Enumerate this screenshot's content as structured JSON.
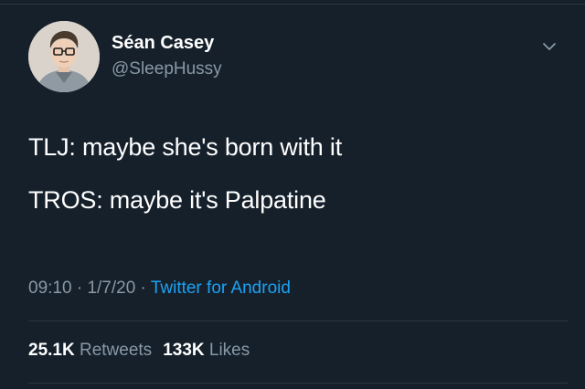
{
  "author": {
    "display_name": "Séan Casey",
    "handle": "@SleepHussy"
  },
  "tweet": {
    "lines": [
      "TLJ: maybe she's born with it",
      "TROS: maybe it's Palpatine"
    ]
  },
  "meta": {
    "time": "09:10",
    "separator": "·",
    "date": "1/7/20",
    "source": "Twitter for Android"
  },
  "stats": {
    "retweets_count": "25.1K",
    "retweets_label": "Retweets",
    "likes_count": "133K",
    "likes_label": "Likes"
  },
  "icons": {
    "more": "chevron-down-icon"
  },
  "colors": {
    "background": "#15202b",
    "text": "#ffffff",
    "secondary": "#8899a6",
    "link": "#1da1f2",
    "divider": "#2b3640"
  }
}
